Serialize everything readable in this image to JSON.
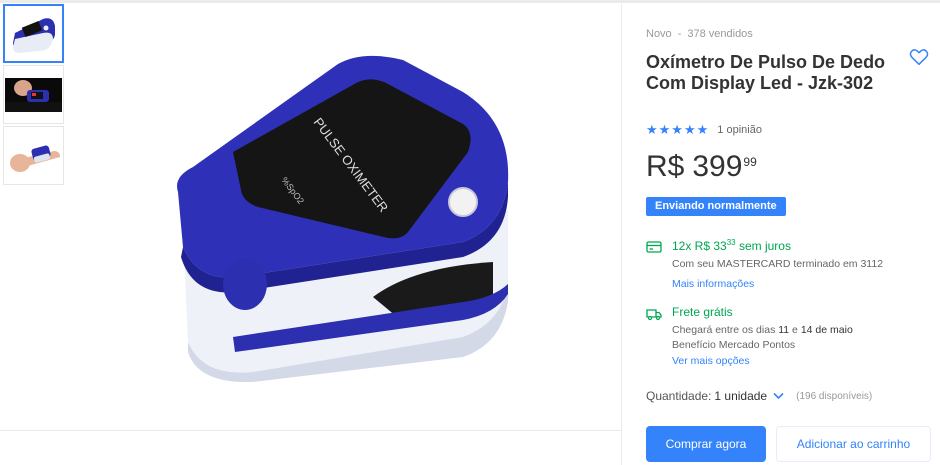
{
  "gallery": {
    "thumbnails": [
      {
        "icon": "oximeter-thumbnail"
      },
      {
        "icon": "oximeter-in-hand-thumbnail"
      },
      {
        "icon": "oximeter-on-finger-thumbnail"
      }
    ],
    "main_image_text": "PULSE OXIMETER",
    "main_image_display": "%SpO2"
  },
  "product": {
    "condition": "Novo",
    "separator": "-",
    "sold": "378 vendidos",
    "title": "Oxímetro De Pulso De Dedo Com Display Led - Jzk-302",
    "rating": {
      "stars": 5,
      "stars_text": "★★★★★",
      "reviews": "1 opinião"
    },
    "price": {
      "currency": "R$",
      "integer": "399",
      "cents": "99"
    },
    "shipping_badge": "Enviando normalmente"
  },
  "installments": {
    "prefix": "12x R$ 33",
    "cents": "33",
    "suffix": " sem juros",
    "card_text": "Com seu MASTERCARD terminado em 3112",
    "link": "Mais informações"
  },
  "shipping": {
    "title": "Frete grátis",
    "arrival_prefix": "Chegará entre os dias ",
    "day_from": "11",
    "middle": " e ",
    "day_to": "14 de maio",
    "benefit": "Benefício Mercado Pontos",
    "link": "Ver mais opções"
  },
  "quantity": {
    "label": "Quantidade:",
    "value": "1 unidade",
    "available": "(196 disponíveis)"
  },
  "actions": {
    "buy": "Comprar agora",
    "cart": "Adicionar ao carrinho"
  },
  "colors": {
    "accent": "#3483fa",
    "green": "#00a650",
    "device_blue": "#2b2fb0"
  }
}
